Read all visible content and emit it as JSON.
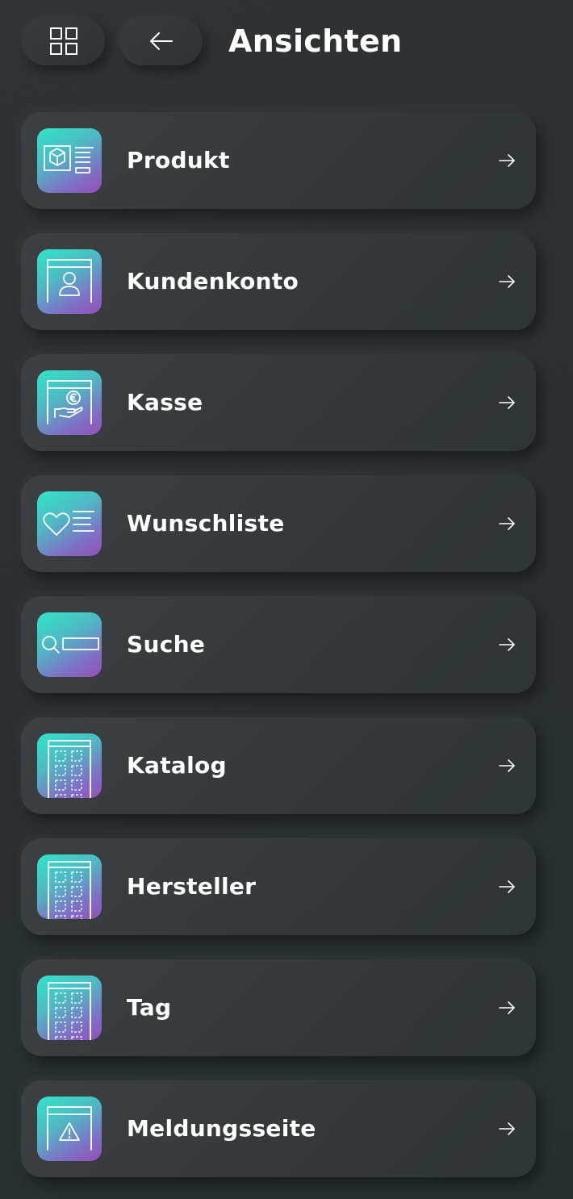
{
  "header": {
    "title": "Ansichten",
    "grid_icon": "grid-icon",
    "back_icon": "arrow-left-icon"
  },
  "items": [
    {
      "label": "Produkt",
      "icon": "product-icon"
    },
    {
      "label": "Kundenkonto",
      "icon": "customer-account-icon"
    },
    {
      "label": "Kasse",
      "icon": "checkout-icon"
    },
    {
      "label": "Wunschliste",
      "icon": "wishlist-icon"
    },
    {
      "label": "Suche",
      "icon": "search-icon"
    },
    {
      "label": "Katalog",
      "icon": "catalog-icon"
    },
    {
      "label": "Hersteller",
      "icon": "manufacturer-icon"
    },
    {
      "label": "Tag",
      "icon": "tag-icon"
    },
    {
      "label": "Meldungsseite",
      "icon": "notice-page-icon"
    }
  ],
  "colors": {
    "background": "#2d3133",
    "card": "#383c3e",
    "tile_gradient_start": "#2fe6c8",
    "tile_gradient_end": "#9350b8",
    "text": "#ffffff"
  }
}
